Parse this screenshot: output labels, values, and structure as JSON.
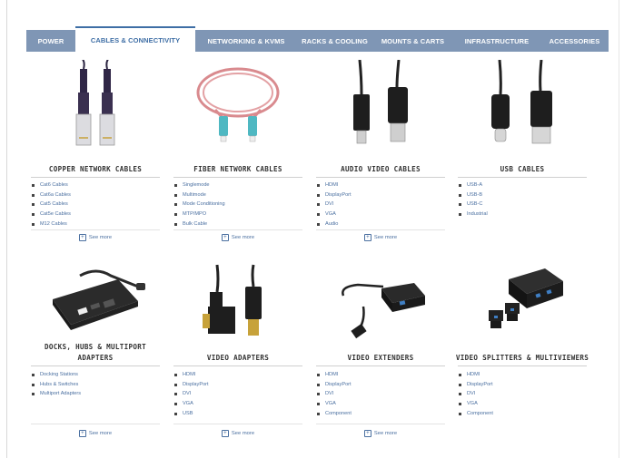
{
  "nav": {
    "tabs": [
      {
        "label": "POWER",
        "active": false
      },
      {
        "label": "CABLES & CONNECTIVITY",
        "active": true
      },
      {
        "label": "NETWORKING & KVMS",
        "active": false
      },
      {
        "label": "RACKS & COOLING",
        "active": false
      },
      {
        "label": "MOUNTS & CARTS",
        "active": false
      },
      {
        "label": "INFRASTRUCTURE",
        "active": false
      },
      {
        "label": "ACCESSORIES",
        "active": false
      }
    ]
  },
  "see_more_label": "See more",
  "tiles": [
    {
      "title": "COPPER NETWORK CABLES",
      "items": [
        "Cat6 Cables",
        "Cat6a Cables",
        "Cat5 Cables",
        "Cat5e Cables",
        "M12 Cables"
      ],
      "image": "copper-cables-image"
    },
    {
      "title": "FIBER NETWORK CABLES",
      "items": [
        "Singlemode",
        "Multimode",
        "Mode Conditioning",
        "MTP/MPO",
        "Bulk Cable"
      ],
      "image": "fiber-cable-image"
    },
    {
      "title": "AUDIO VIDEO CABLES",
      "items": [
        "HDMI",
        "DisplayPort",
        "DVI",
        "VGA",
        "Audio"
      ],
      "image": "av-cables-image"
    },
    {
      "title": "USB CABLES",
      "items": [
        "USB-A",
        "USB-B",
        "USB-C",
        "Industrial"
      ],
      "image": "usb-cables-image"
    },
    {
      "title": "DOCKS, HUBS & MULTIPORT ADAPTERS",
      "items": [
        "Docking Stations",
        "Hubs & Switches",
        "Multiport Adapters"
      ],
      "image": "dock-image"
    },
    {
      "title": "VIDEO ADAPTERS",
      "items": [
        "HDMI",
        "DisplayPort",
        "DVI",
        "VGA",
        "USB"
      ],
      "image": "video-adapter-image"
    },
    {
      "title": "VIDEO EXTENDERS",
      "items": [
        "HDMI",
        "DisplayPort",
        "DVI",
        "VGA",
        "Component"
      ],
      "image": "video-extender-image"
    },
    {
      "title": "VIDEO SPLITTERS & MULTIVIEWERS",
      "items": [
        "HDMI",
        "DisplayPort",
        "DVI",
        "VGA",
        "Component"
      ],
      "image": "video-splitter-image"
    }
  ]
}
